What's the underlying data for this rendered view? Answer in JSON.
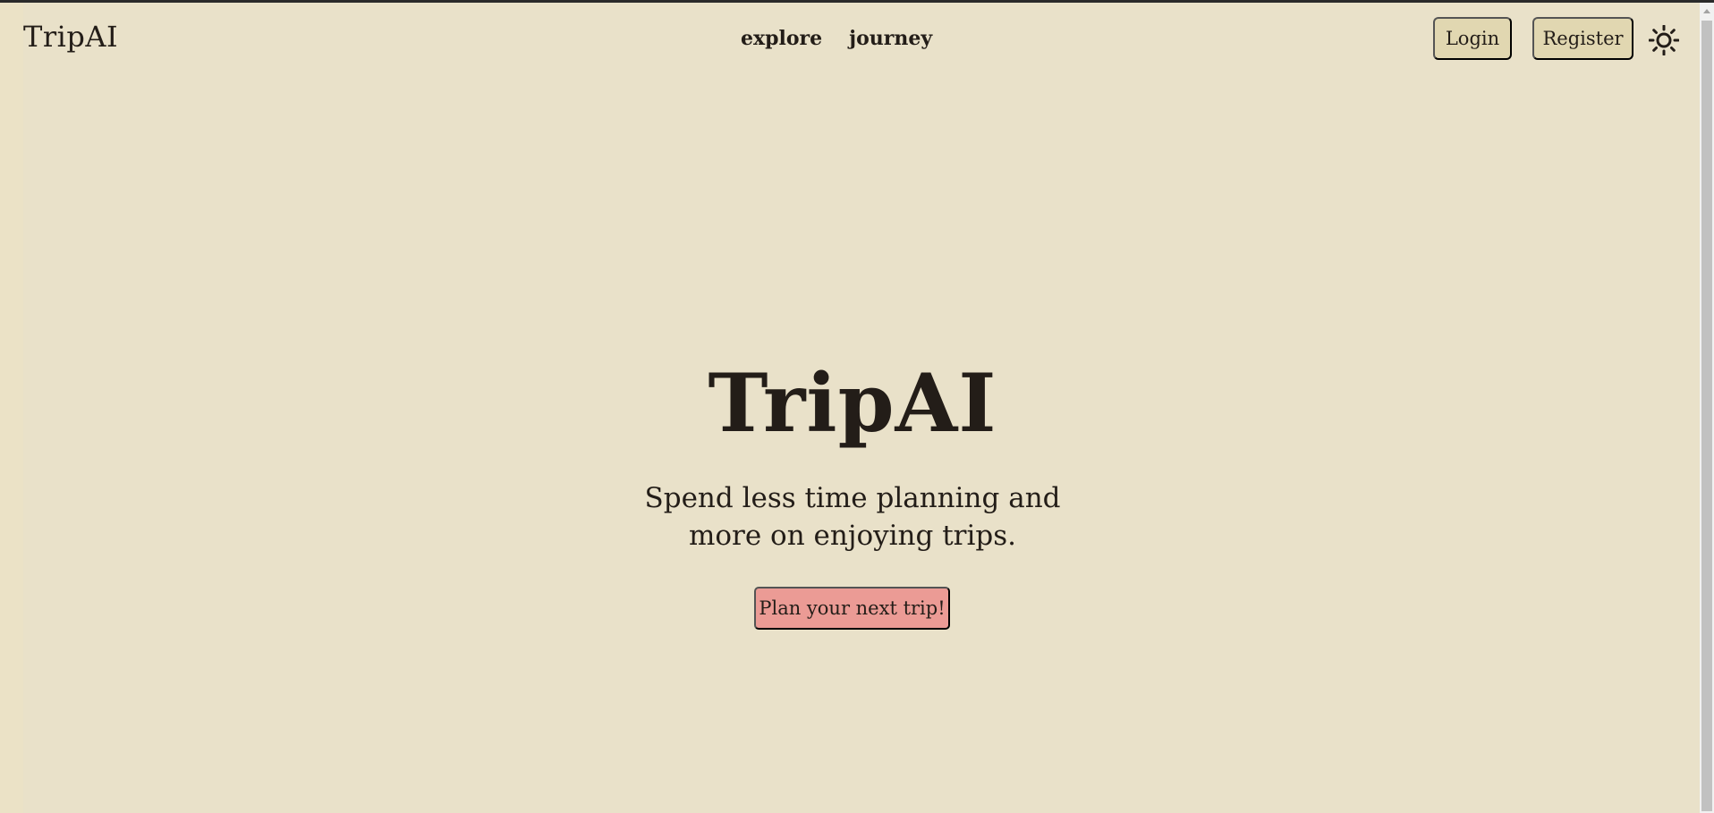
{
  "header": {
    "brand": "TripAI",
    "nav": [
      {
        "label": "explore"
      },
      {
        "label": "journey"
      }
    ],
    "login_label": "Login",
    "register_label": "Register",
    "theme_icon": "sun-icon"
  },
  "hero": {
    "title": "TripAI",
    "subtitle_lines": [
      "Spend less time planning and",
      "more on enjoying trips."
    ],
    "cta_label": "Plan your next trip!"
  },
  "colors": {
    "background": "#e9e1c9",
    "nav_button": "#e1d7b1",
    "cta": "#eb9b95",
    "text": "#231d18"
  }
}
